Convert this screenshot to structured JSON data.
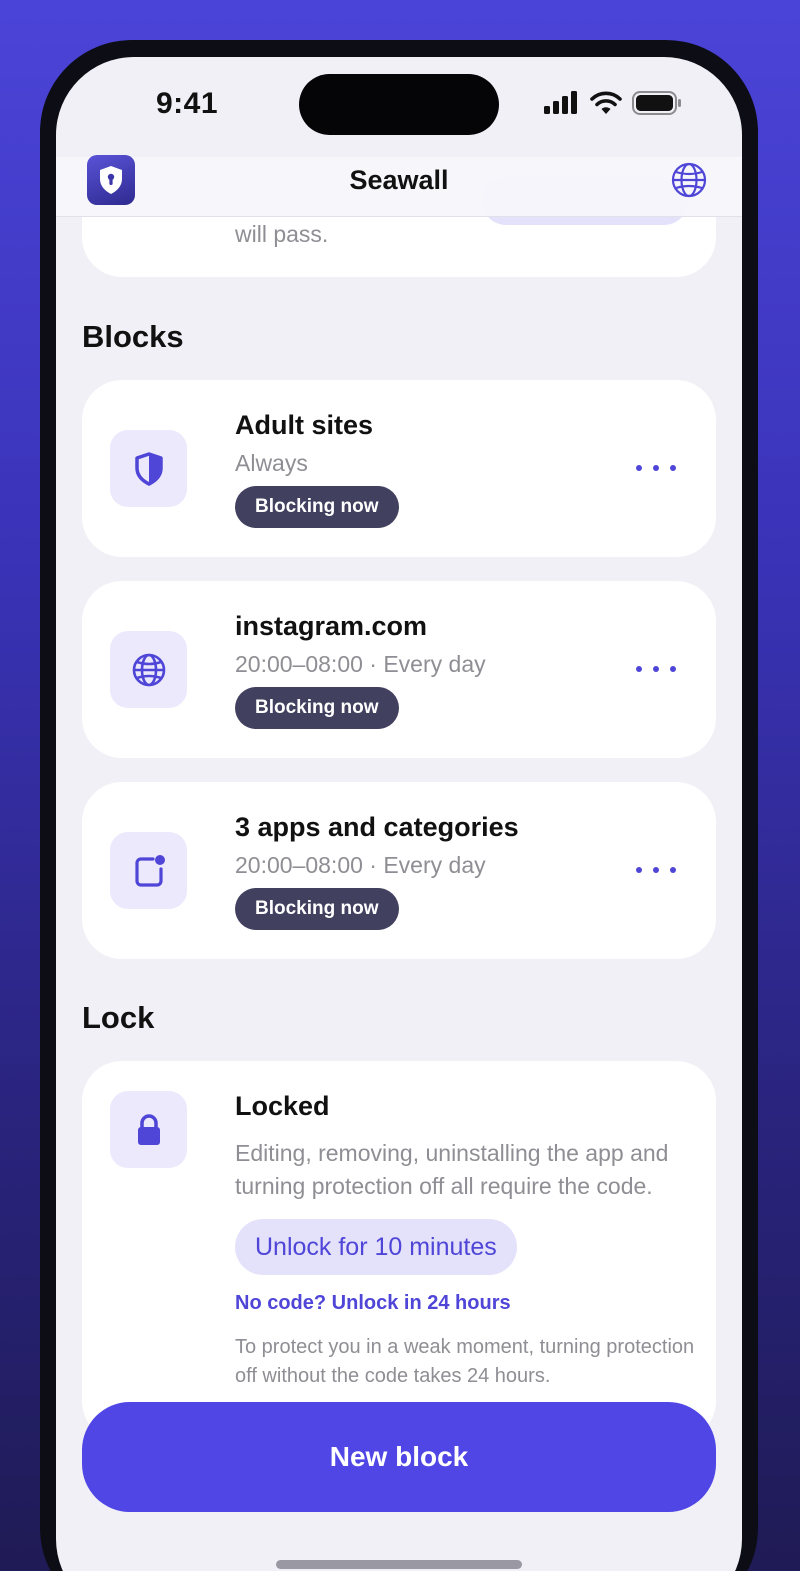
{
  "status_bar": {
    "time": "9:41"
  },
  "nav": {
    "title": "Seawall",
    "logo_icon": "shield-keyhole-icon",
    "right_icon": "globe-icon"
  },
  "top_partial": {
    "text": "will pass."
  },
  "blocks": {
    "heading": "Blocks",
    "items": [
      {
        "title": "Adult sites",
        "subtitle": "Always",
        "badge": "Blocking now",
        "icon": "shield-icon"
      },
      {
        "title": "instagram.com",
        "subtitle": "20:00–08:00 · Every day",
        "badge": "Blocking now",
        "icon": "globe-icon"
      },
      {
        "title": "3 apps and categories",
        "subtitle": "20:00–08:00 · Every day",
        "badge": "Blocking now",
        "icon": "app-icon"
      }
    ]
  },
  "lock": {
    "heading": "Lock",
    "title": "Locked",
    "description": "Editing, removing, uninstalling the app and turning protection off all require the code.",
    "unlock_button": "Unlock for 10 minutes",
    "no_code_link": "No code? Unlock in 24 hours",
    "note": "To protect you in a weak moment, turning protection off without the code takes 24 hours."
  },
  "primary_button": {
    "label": "New block"
  },
  "colors": {
    "accent": "#4f46e5",
    "badge_bg": "#41405f",
    "tile_bg": "#ebe9fb",
    "screen_bg": "#f1f0f6"
  }
}
